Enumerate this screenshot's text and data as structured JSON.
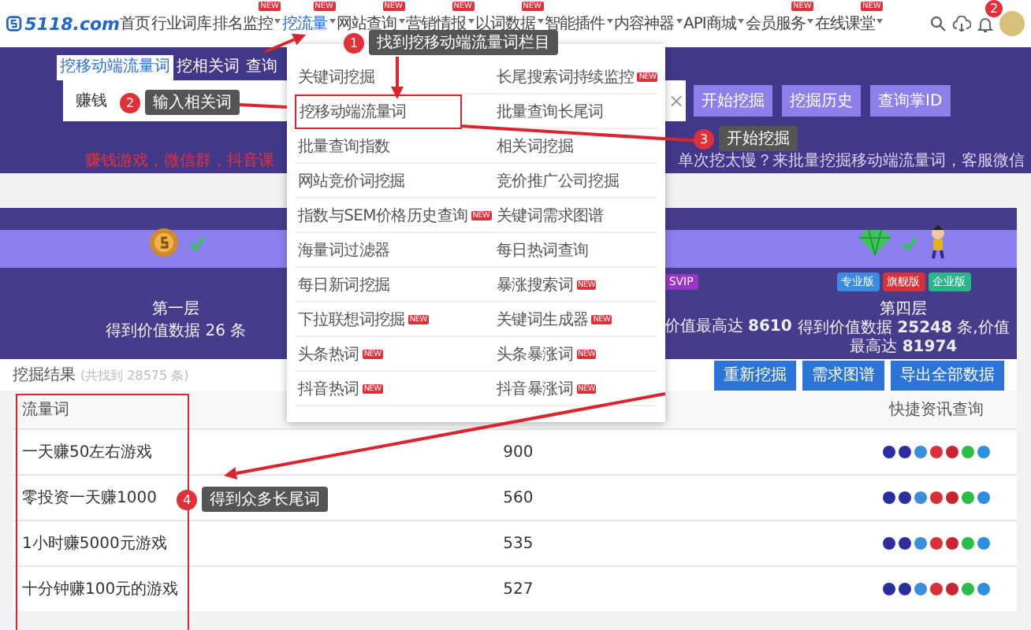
{
  "nav": {
    "logo": "5118.com",
    "items": [
      {
        "label": "首页",
        "dropdown": false,
        "selected": false
      },
      {
        "label": "行业词库",
        "dropdown": false,
        "selected": false
      },
      {
        "label": "排名监控",
        "dropdown": true,
        "badge": "NEW",
        "selected": false
      },
      {
        "label": "挖流量",
        "dropdown": true,
        "badge": "NEW",
        "selected": true
      },
      {
        "label": "网站查询",
        "dropdown": true,
        "badge": "NEW",
        "selected": false
      },
      {
        "label": "营销情报",
        "dropdown": true,
        "badge": "NEW",
        "selected": false
      },
      {
        "label": "以词数据",
        "dropdown": true,
        "badge": "NEW",
        "selected": false
      },
      {
        "label": "智能插件",
        "dropdown": true,
        "selected": false
      },
      {
        "label": "内容神器",
        "dropdown": true,
        "selected": false
      },
      {
        "label": "API商城",
        "dropdown": true,
        "selected": false
      },
      {
        "label": "会员服务",
        "dropdown": true,
        "badge": "NEW",
        "selected": false
      },
      {
        "label": "在线课堂",
        "dropdown": true,
        "badge": "NEW",
        "selected": false
      }
    ],
    "notifications": "2"
  },
  "search_panel": {
    "tabs": [
      {
        "label": "挖移动端流量词",
        "selected": true
      },
      {
        "label": "挖相关词",
        "selected": false
      },
      {
        "label": "查询",
        "selected": false
      }
    ],
    "input_value": "赚钱",
    "clear": "×",
    "buttons": [
      "开始挖掘",
      "挖掘历史",
      "查询掌ID"
    ],
    "examples": "赚钱游戏，微信群，抖音课",
    "promo": "单次挖太慢？来批量挖掘移动端流量词，客服微信"
  },
  "levels": {
    "first": {
      "title": "第一层",
      "desc": "得到价值数据 26 条"
    },
    "middle": {
      "badge": "SVIP",
      "desc": "价值最高达 **8610**"
    },
    "last": {
      "badges": [
        "专业版",
        "旗舰版",
        "企业版"
      ],
      "title": "第四层",
      "desc": "得到价值数据 **25248** 条,价值最高达 **81974**"
    }
  },
  "results": {
    "title": "挖掘结果",
    "count": "(共找到 28575 条)",
    "buttons": [
      "重新挖掘",
      "需求图谱",
      "导出全部数据"
    ]
  },
  "table": {
    "columns": [
      "流量词",
      "快捷资讯查询"
    ],
    "rows": [
      {
        "keyword": "一天赚50左右游戏",
        "value": "900"
      },
      {
        "keyword": "零投资一天赚1000",
        "value": "560"
      },
      {
        "keyword": "1小时赚5000元游戏",
        "value": "535"
      },
      {
        "keyword": "十分钟赚100元的游戏",
        "value": "527"
      }
    ]
  },
  "menu": {
    "columns": [
      [
        {
          "label": "关键词挖掘",
          "selected": false
        },
        {
          "label": "挖移动端流量词",
          "selected": true
        },
        {
          "label": "批量查询指数",
          "selected": false
        },
        {
          "label": "网站竞价词挖掘",
          "selected": false
        },
        {
          "label": "指数与SEM价格历史查询",
          "badge": "NEW",
          "selected": false
        },
        {
          "label": "海量词过滤器",
          "selected": false
        },
        {
          "label": "每日新词挖掘",
          "selected": false
        },
        {
          "label": "下拉联想词挖掘",
          "badge": "NEW",
          "selected": false
        },
        {
          "label": "头条热词",
          "badge": "NEW",
          "selected": false
        },
        {
          "label": "抖音热词",
          "badge": "NEW",
          "selected": false
        }
      ],
      [
        {
          "label": "长尾搜索词持续监控",
          "badge": "NEW",
          "selected": false
        },
        {
          "label": "批量查询长尾词",
          "selected": false
        },
        {
          "label": "相关词挖掘",
          "selected": false
        },
        {
          "label": "竞价推广公司挖掘",
          "selected": false
        },
        {
          "label": "关键词需求图谱",
          "selected": false
        },
        {
          "label": "每日热词查询",
          "selected": false
        },
        {
          "label": "暴涨搜索词",
          "badge": "NEW",
          "selected": false
        },
        {
          "label": "关键词生成器",
          "badge": "NEW",
          "selected": false
        },
        {
          "label": "头条暴涨词",
          "badge": "NEW",
          "selected": false
        },
        {
          "label": "抖音暴涨词",
          "badge": "NEW",
          "selected": false
        }
      ]
    ]
  },
  "annotations": [
    {
      "number": "1",
      "text": "找到挖移动端流量词栏目"
    },
    {
      "number": "2",
      "text": "输入相关词"
    },
    {
      "number": "3",
      "text": "开始挖掘"
    },
    {
      "number": "4",
      "text": "得到众多长尾词"
    }
  ]
}
